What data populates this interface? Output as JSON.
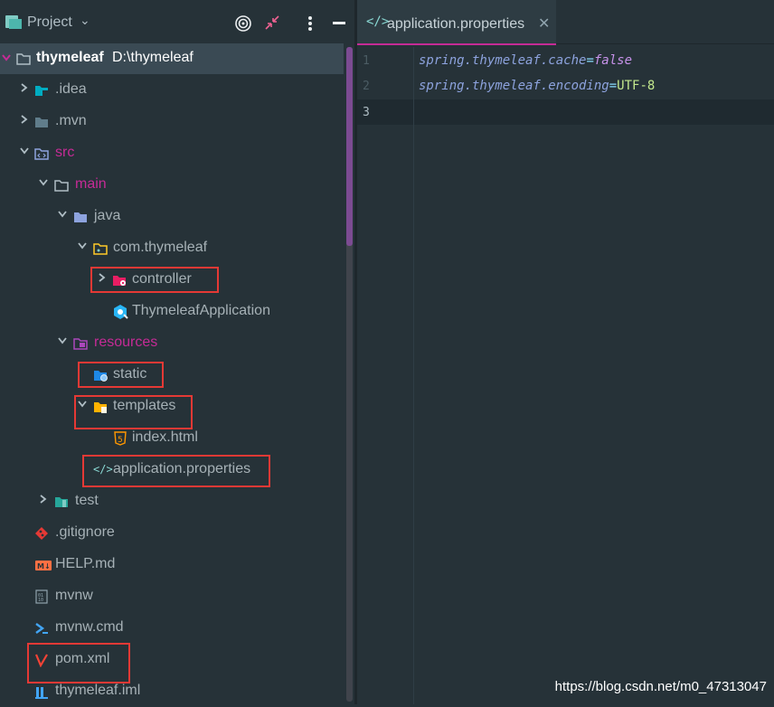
{
  "project_panel": {
    "title": "Project",
    "tree": {
      "root_name": "thymeleaf",
      "root_path": "D:\\thymeleaf",
      "idea": ".idea",
      "mvn": ".mvn",
      "src": "src",
      "main": "main",
      "java": "java",
      "package": "com.thymeleaf",
      "controller": "controller",
      "app_class": "ThymeleafApplication",
      "resources": "resources",
      "static": "static",
      "templates": "templates",
      "index": "index.html",
      "app_props": "application.properties",
      "test": "test",
      "gitignore": ".gitignore",
      "help": "HELP.md",
      "mvnw": "mvnw",
      "mvnw_cmd": "mvnw.cmd",
      "pom": "pom.xml",
      "iml": "thymeleaf.iml"
    }
  },
  "editor": {
    "tab_label": "application.properties",
    "lines": [
      {
        "num": "1",
        "key": "spring.thymeleaf.cache",
        "eq": "=",
        "value": "false"
      },
      {
        "num": "2",
        "key": "spring.thymeleaf.encoding",
        "eq": "=",
        "value": "UTF-8"
      },
      {
        "num": "3",
        "key": "",
        "eq": "",
        "value": ""
      }
    ]
  },
  "watermark": "https://blog.csdn.net/m0_47313047",
  "colors": {
    "background": "#263238",
    "accent": "#c52b96",
    "highlight_box": "#e53935",
    "folder_src": "#c52b96",
    "key_color": "#8da3de",
    "value_color": "#c792ea"
  }
}
